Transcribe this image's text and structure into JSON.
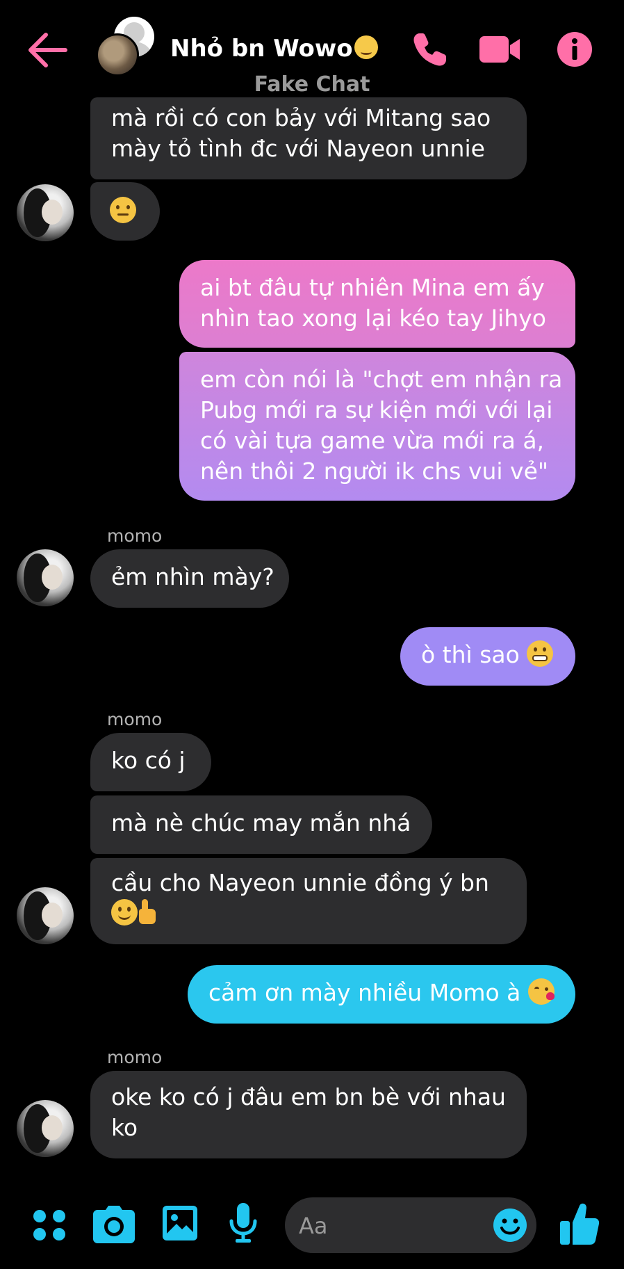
{
  "header": {
    "title": "Nhỏ bn Wowo",
    "subtitle": "Fake Chat",
    "icons": [
      "back-arrow-icon",
      "phone-icon",
      "video-camera-icon",
      "info-icon"
    ],
    "accent_color": "#ff6fa8"
  },
  "messages": [
    {
      "id": "m1",
      "direction": "in",
      "lines": [
        "mà rồi có con bảy với Mitang sao",
        "mày tỏ tình đc với Nayeon unnie"
      ]
    },
    {
      "id": "m2",
      "direction": "in",
      "emoji": "raised-eyebrow-face"
    },
    {
      "id": "m3",
      "direction": "out",
      "lines": [
        "ai bt đâu tự nhiên Mina em ấy",
        "nhìn tao xong lại kéo tay Jihyo"
      ]
    },
    {
      "id": "m4",
      "direction": "out",
      "lines": [
        "em còn nói là \"chợt em nhận ra",
        "Pubg mới ra sự kiện mới với lại",
        "có vài tựa game vừa mới ra á,",
        "nên thôi 2 người ik chs vui vẻ\""
      ]
    },
    {
      "id": "m5",
      "direction": "in",
      "sender": "momo",
      "lines": [
        "ẻm nhìn mày?"
      ]
    },
    {
      "id": "m6",
      "direction": "out",
      "lines": [
        "ò thì sao"
      ],
      "emoji": "grimacing-face"
    },
    {
      "id": "m7",
      "direction": "in",
      "sender": "momo",
      "lines": [
        "ko có j"
      ]
    },
    {
      "id": "m8",
      "direction": "in",
      "lines": [
        "mà nè chúc may mắn nhá"
      ]
    },
    {
      "id": "m9",
      "direction": "in",
      "lines": [
        "cầu cho Nayeon unnie đồng ý bn"
      ],
      "emoji": "smiling-face-thumbs-up"
    },
    {
      "id": "m10",
      "direction": "out",
      "lines": [
        "cảm ơn mày nhiều Momo à"
      ],
      "emoji": "face-blowing-kiss"
    },
    {
      "id": "m11",
      "direction": "in",
      "sender": "momo",
      "lines": [
        "oke ko có j đâu em bn bè với nhau",
        "ko"
      ]
    }
  ],
  "senders": {
    "momo": "momo"
  },
  "bubble_colors": {
    "incoming": "#2d2d2f",
    "out_gradient_top": "#e979c8",
    "out_gradient_bottom": "#b88af0",
    "out_m6": "#a08bf5",
    "out_m10": "#2bc7ee"
  },
  "composer": {
    "placeholder": "Aa",
    "toolbar_icons": [
      "menu-dots-icon",
      "camera-icon",
      "image-icon",
      "microphone-icon",
      "emoji-icon",
      "thumbs-up-icon"
    ],
    "toolbar_color": "#22c6f0"
  }
}
